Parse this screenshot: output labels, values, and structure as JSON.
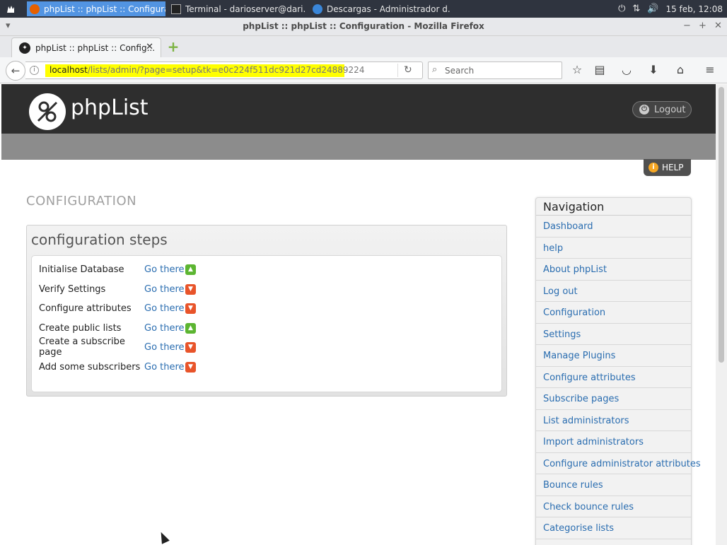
{
  "taskbar": {
    "tasks": [
      {
        "label": "phpList :: phpList :: Configura..."
      },
      {
        "label": "Terminal - darioserver@dari..."
      },
      {
        "label": "Descargas - Administrador d..."
      }
    ],
    "clock": "15 feb, 12:08"
  },
  "window": {
    "title": "phpList :: phpList :: Configuration - Mozilla Firefox"
  },
  "browser": {
    "tab_title": "phpList :: phpList :: Config...",
    "url_host": "localhost",
    "url_path": "/lists/admin/?page=setup&tk=e0c224f511dc921d27cd24889224",
    "search_placeholder": "Search"
  },
  "page": {
    "logo_text": "phpList",
    "logout_label": "Logout",
    "help_label": "HELP",
    "title": "CONFIGURATION",
    "panel_title": "configuration steps",
    "steps": [
      {
        "name": "Initialise Database",
        "link": "Go there",
        "status": "ok"
      },
      {
        "name": "Verify Settings",
        "link": "Go there",
        "status": "pending"
      },
      {
        "name": "Configure attributes",
        "link": "Go there",
        "status": "pending"
      },
      {
        "name": "Create public lists",
        "link": "Go there",
        "status": "ok"
      },
      {
        "name": "Create a subscribe page",
        "link": "Go there",
        "status": "pending"
      },
      {
        "name": "Add some subscribers",
        "link": "Go there",
        "status": "pending"
      }
    ],
    "navigation": {
      "title": "Navigation",
      "items": [
        "Dashboard",
        "help",
        "About phpList",
        "Log out",
        "Configuration",
        "Settings",
        "Manage Plugins",
        "Configure attributes",
        "Subscribe pages",
        "List administrators",
        "Import administrators",
        "Configure administrator attributes",
        "Bounce rules",
        "Check bounce rules",
        "Categorise lists"
      ]
    }
  },
  "colors": {
    "header_bg": "#2e2e2e",
    "subheader_bg": "#8c8c8c",
    "link": "#2a6db0",
    "status_ok": "#5cb531",
    "status_pending": "#e8542a",
    "url_highlight": "#ffff00"
  }
}
